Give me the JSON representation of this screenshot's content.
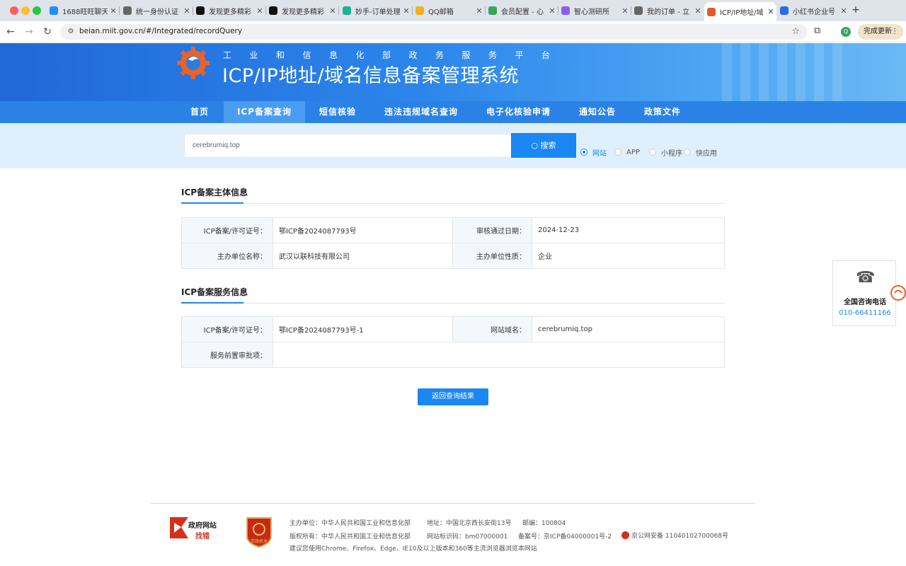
{
  "browser": {
    "tabs": [
      {
        "title": "1688旺旺聊天",
        "color": "#1f8fff"
      },
      {
        "title": "统一身份认证",
        "color": "#666666"
      },
      {
        "title": "发现更多精彩",
        "color": "#111111"
      },
      {
        "title": "发现更多精彩",
        "color": "#111111"
      },
      {
        "title": "妙手-订单处理",
        "color": "#19b39a"
      },
      {
        "title": "QQ邮箱",
        "color": "#f3b11a"
      },
      {
        "title": "会员配置 - 心",
        "color": "#3aa55c"
      },
      {
        "title": "智心测研所",
        "color": "#8a5cf6"
      },
      {
        "title": "我的订单 - 立",
        "color": "#666666"
      },
      {
        "title": "ICP/IP地址/域",
        "color": "#e35a2a"
      },
      {
        "title": "小红书企业号",
        "color": "#2d6cdf"
      }
    ],
    "close_glyph": "✕",
    "new_tab": "+",
    "url": "beian.miit.gov.cn/#/Integrated/recordQuery",
    "profile_initial": "Q",
    "update_label": "完成更新",
    "update_menu": "⋮"
  },
  "header": {
    "subtitle": "工业和信息化部政务服务平台",
    "title": "ICP/IP地址/域名信息备案管理系统"
  },
  "nav": {
    "items": [
      "首页",
      "ICP备案查询",
      "短信核验",
      "违法违规域名查询",
      "电子化核验申请",
      "通知公告",
      "政策文件"
    ],
    "active_index": 1
  },
  "search": {
    "value": "cerebrumiq.top",
    "button_label": "搜索",
    "types": [
      "网站",
      "APP",
      "小程序",
      "快应用"
    ],
    "selected_type": "网站"
  },
  "subject_info": {
    "title": "ICP备案主体信息",
    "rows": [
      {
        "label1": "ICP备案/许可证号：",
        "value1": "鄂ICP备2024087793号",
        "label2": "审核通过日期：",
        "value2": "2024-12-23"
      },
      {
        "label1": "主办单位名称：",
        "value1": "武汉以联科技有限公司",
        "label2": "主办单位性质：",
        "value2": "企业"
      }
    ]
  },
  "service_info": {
    "title": "ICP备案服务信息",
    "row1": {
      "label1": "ICP备案/许可证号：",
      "value1": "鄂ICP备2024087793号-1",
      "label2": "网站域名：",
      "value2": "cerebrumiq.top"
    },
    "row2": {
      "label1": "服务前置审批项：",
      "value1": ""
    }
  },
  "return_button": "返回查询结果",
  "side_contact": {
    "label": "全国咨询电话",
    "phone": "010-66411166"
  },
  "footer": {
    "logo1_top": "政府网站",
    "logo1_bottom": "找错",
    "logo2_text": "党政机关",
    "line1_org": "主办单位：中华人民共和国工业和信息化部",
    "line1_addr": "地址：中国北京西长安街13号",
    "line1_zip": "邮编：100804",
    "line2_copy": "版权所有：中华人民共和国工业和信息化部",
    "line2_code": "网站标识码：bm07000001",
    "line2_icp": "备案号：京ICP备04000001号-2",
    "line2_police": "京公网安备 11040102700068号",
    "line3": "建议您使用Chrome、Firefox、Edge、IE10及以上版本和360等主流浏览器浏览本网站"
  },
  "colors": {
    "primary": "#1a87f3",
    "nav_bg": "#2b82e6",
    "nav_active": "#4a9cf0",
    "search_band": "#dff0fc"
  }
}
